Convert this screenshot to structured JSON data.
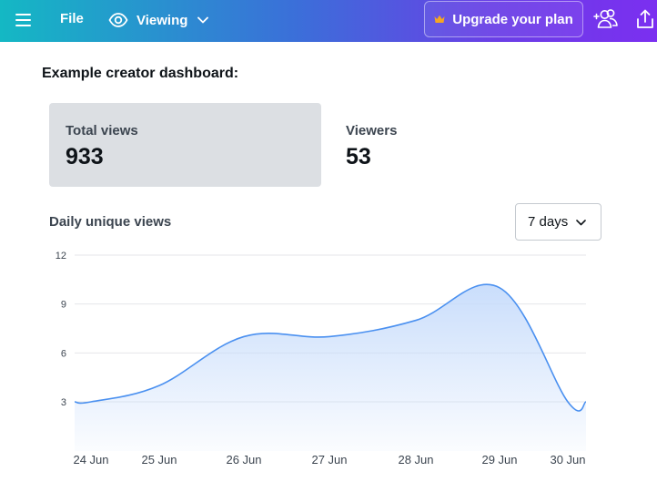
{
  "topbar": {
    "file_label": "File",
    "viewing_label": "Viewing",
    "upgrade_label": "Upgrade your plan"
  },
  "page": {
    "heading": "Example creator dashboard:"
  },
  "stats": [
    {
      "label": "Total views",
      "value": "933"
    },
    {
      "label": "Viewers",
      "value": "53"
    }
  ],
  "chart_section": {
    "title": "Daily unique views",
    "range_selected": "7 days"
  },
  "colors": {
    "accent_line": "#4a90f0",
    "area_fill": "#c7dcfb",
    "crown": "#f5a623"
  },
  "chart_data": {
    "type": "area",
    "title": "Daily unique views",
    "xlabel": "",
    "ylabel": "",
    "categories": [
      "24 Jun",
      "25 Jun",
      "26 Jun",
      "27 Jun",
      "28 Jun",
      "29 Jun",
      "30 Jun"
    ],
    "values": [
      3,
      4,
      7,
      7,
      8,
      10,
      3
    ],
    "ylim": [
      0,
      12
    ],
    "yticks": [
      3,
      6,
      9,
      12
    ],
    "grid": true,
    "legend": "none"
  }
}
